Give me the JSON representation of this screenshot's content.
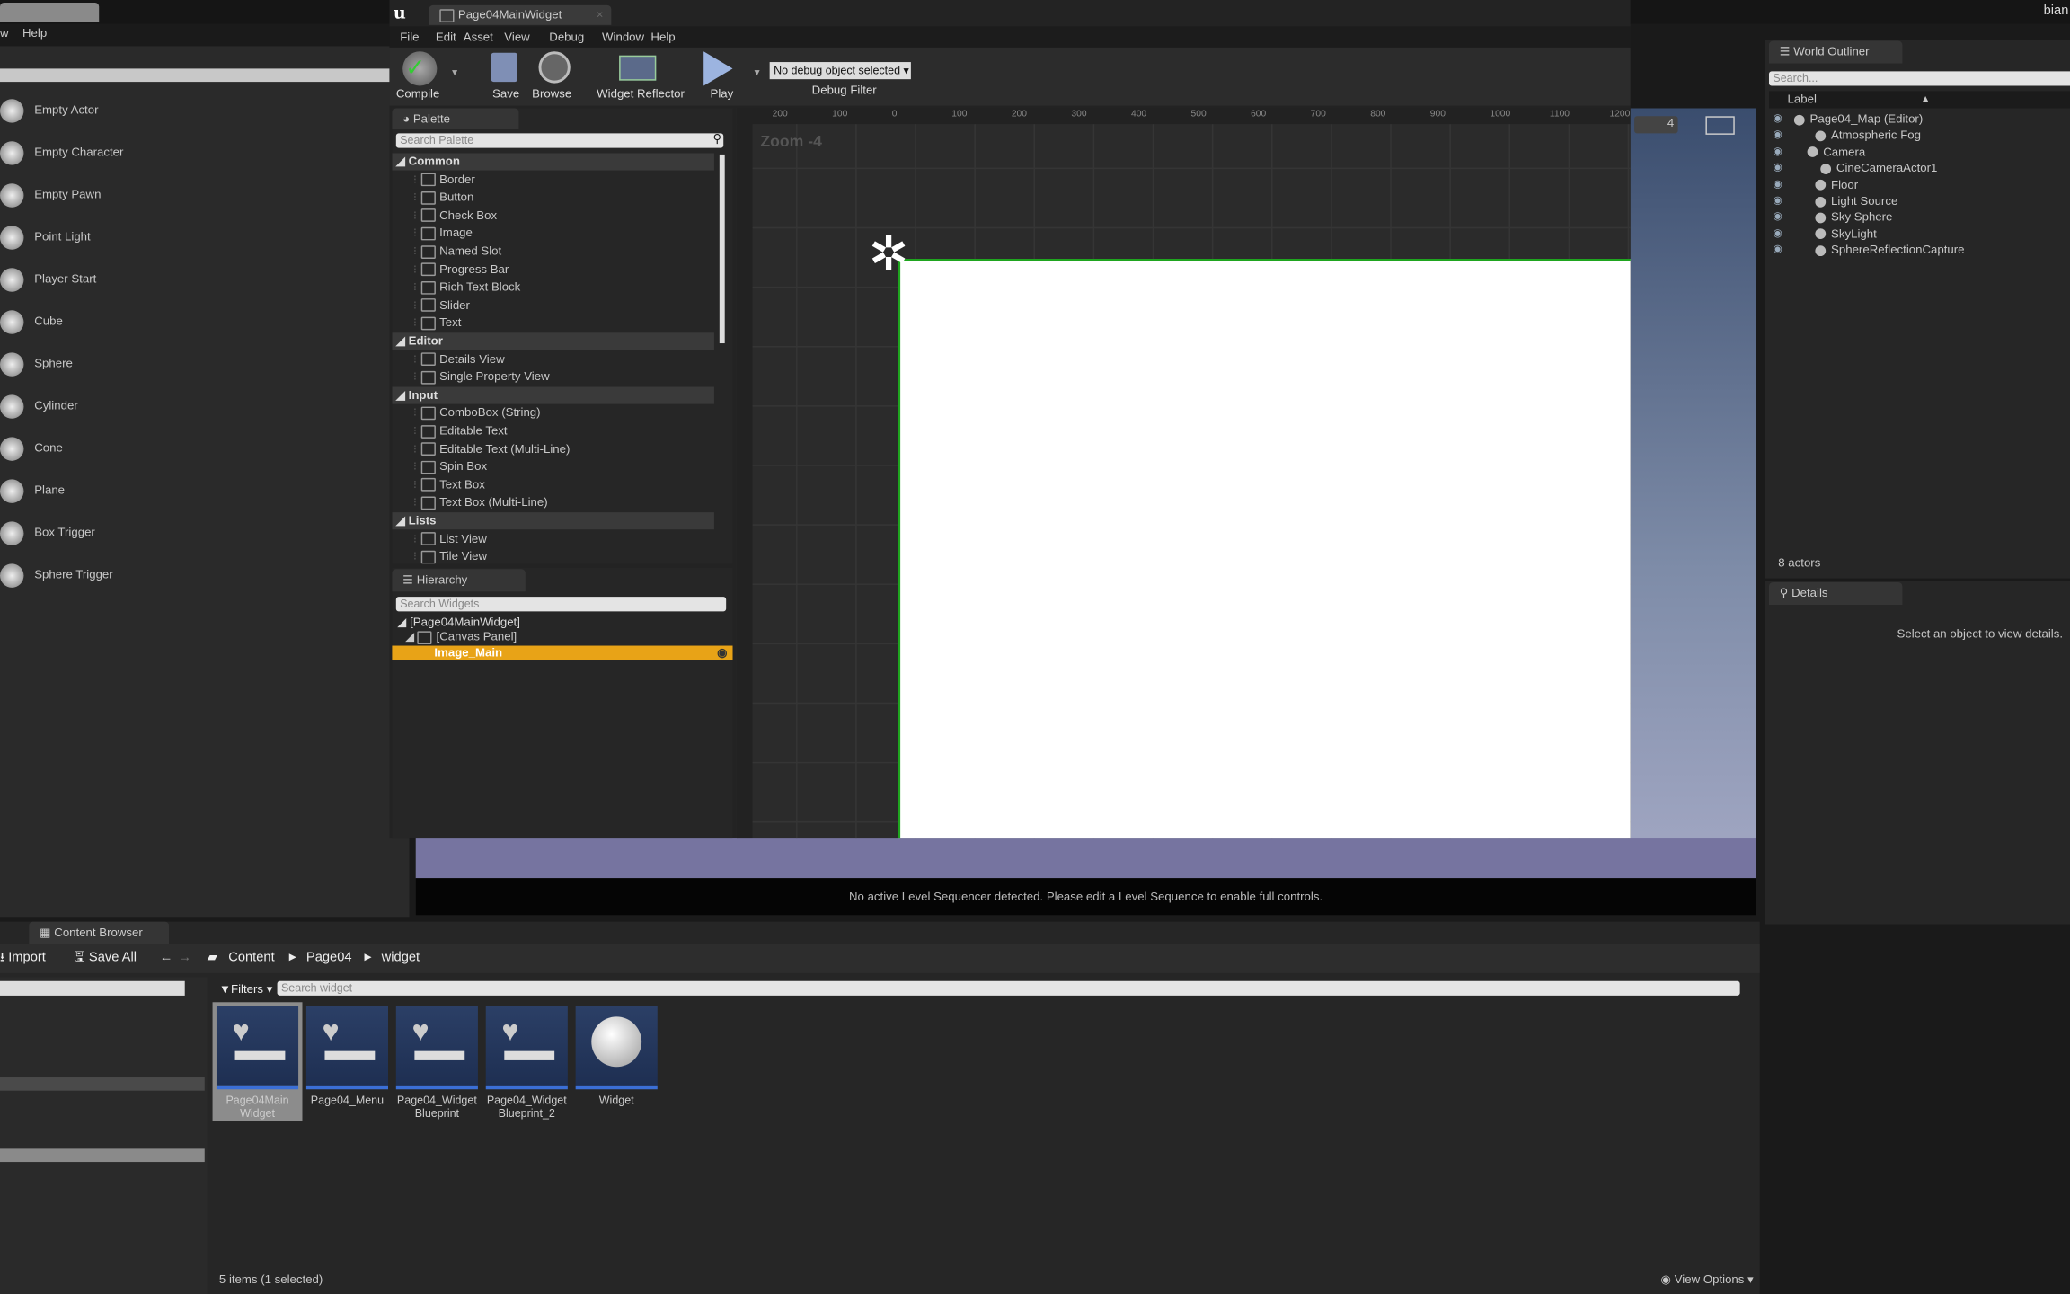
{
  "top": {
    "left_tab": "",
    "menu": [
      "w",
      "Help"
    ],
    "user": "bian"
  },
  "place_actors": {
    "items": [
      "Empty Actor",
      "Empty Character",
      "Empty Pawn",
      "Point Light",
      "Player Start",
      "Cube",
      "Sphere",
      "Cylinder",
      "Cone",
      "Plane",
      "Box Trigger",
      "Sphere Trigger"
    ]
  },
  "widget_editor": {
    "tab_title": "Page04MainWidget",
    "menu": [
      "File",
      "Edit",
      "Asset",
      "View",
      "Debug",
      "Window",
      "Help"
    ],
    "toolbar": {
      "compile": "Compile",
      "save": "Save",
      "browse": "Browse",
      "reflector": "Widget Reflector",
      "play": "Play",
      "debug_select": "No debug object selected",
      "debug_filter": "Debug Filter"
    },
    "palette": {
      "title": "Palette",
      "search_placeholder": "Search Palette",
      "sections": [
        {
          "name": "Common",
          "items": [
            "Border",
            "Button",
            "Check Box",
            "Image",
            "Named Slot",
            "Progress Bar",
            "Rich Text Block",
            "Slider",
            "Text"
          ]
        },
        {
          "name": "Editor",
          "items": [
            "Details View",
            "Single Property View"
          ]
        },
        {
          "name": "Input",
          "items": [
            "ComboBox (String)",
            "Editable Text",
            "Editable Text (Multi-Line)",
            "Spin Box",
            "Text Box",
            "Text Box (Multi-Line)"
          ]
        },
        {
          "name": "Lists",
          "items": [
            "List View",
            "Tile View"
          ]
        }
      ]
    },
    "hierarchy": {
      "title": "Hierarchy",
      "search_placeholder": "Search Widgets",
      "items": [
        "[Page04MainWidget]",
        "[Canvas Panel]",
        "Image_Main"
      ],
      "selected": "Image_Main"
    },
    "designer": {
      "zoom": "Zoom -4",
      "ruler_x": [
        "200",
        "100",
        "0",
        "100",
        "200",
        "300",
        "400",
        "500",
        "600",
        "700",
        "800",
        "900",
        "1000",
        "1100",
        "1200"
      ]
    }
  },
  "viewport": {
    "sequencer_msg": "No active Level Sequencer detected. Please edit a Level Sequence to enable full controls.",
    "camera_speed": "4"
  },
  "outliner": {
    "title": "World Outliner",
    "search_placeholder": "Search...",
    "column": "Label",
    "items": [
      "Page04_Map (Editor)",
      "Atmospheric Fog",
      "Camera",
      "CineCameraActor1",
      "Floor",
      "Light Source",
      "Sky Sphere",
      "SkyLight",
      "SphereReflectionCapture"
    ],
    "count": "8 actors"
  },
  "details": {
    "title": "Details",
    "empty": "Select an object to view details."
  },
  "content_browser": {
    "title": "Content Browser",
    "import": "Import",
    "save_all": "Save All",
    "path": [
      "Content",
      "Page04",
      "widget"
    ],
    "filters": "Filters",
    "search_placeholder": "Search widget",
    "assets": [
      {
        "name": "Page04Main Widget",
        "selected": true
      },
      {
        "name": "Page04_Menu"
      },
      {
        "name": "Page04_Widget Blueprint"
      },
      {
        "name": "Page04_Widget Blueprint_2"
      },
      {
        "name": "Widget"
      }
    ],
    "status": "5 items (1 selected)",
    "view_options": "View Options"
  },
  "colors": {
    "selection": "#e8a317",
    "canvas_border": "#1fa51f",
    "asset_bar": "#3b6fd6"
  }
}
